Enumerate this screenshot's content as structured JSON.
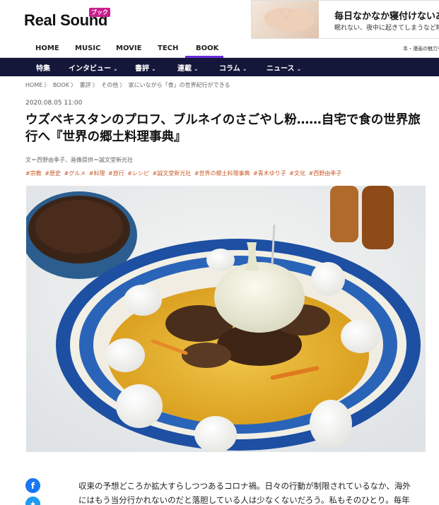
{
  "brand": {
    "logo": "Real Sound",
    "badge": "ブック"
  },
  "ad": {
    "title": "毎日なかなか寝付けないあなたへ",
    "text": "眠れない、夜中に起きてしまうなど睡眠のお悩みを"
  },
  "category_nav": {
    "items": [
      "HOME",
      "MUSIC",
      "MOVIE",
      "TECH",
      "BOOK"
    ],
    "active": "BOOK",
    "right_text": "本・漫画の魅力を伝える"
  },
  "main_nav": {
    "items": [
      {
        "label": "特集",
        "has_menu": false
      },
      {
        "label": "インタビュー",
        "has_menu": true
      },
      {
        "label": "書評",
        "has_menu": true
      },
      {
        "label": "連載",
        "has_menu": true
      },
      {
        "label": "コラム",
        "has_menu": true
      },
      {
        "label": "ニュース",
        "has_menu": true
      }
    ]
  },
  "breadcrumb": [
    "HOME",
    "BOOK",
    "書評",
    "その他",
    "家にいながら「食」の世界紀行ができる"
  ],
  "article": {
    "date": "2020.08.05 11:00",
    "title": "ウズベキスタンのプロフ、ブルネイのさごやし粉……自宅で食の世界旅行へ『世界の郷土料理事典』",
    "credit": "文＝西野由季子、画像提供＝誠文堂新光社",
    "tags": [
      "#宗教",
      "#歴史",
      "#グルメ",
      "#料理",
      "#旅行",
      "#レシピ",
      "#誠文堂新光社",
      "#世界の郷土料理事典",
      "#青木ゆり子",
      "#文化",
      "#西野由季子"
    ],
    "body": "収束の予想どころか拡大すらしつつあるコロナ禍。日々の行動が制限されているなか、海外にはもう当分行かれないのだと落胆している人は少なくないだろう。私もそのひとり。毎年のパリ旅行を楽しみに日々の仕事を頑張っていたのに、とため息をつく日々。"
  },
  "share": {
    "icons": [
      "facebook-icon",
      "twitter-icon"
    ]
  },
  "colors": {
    "accent": "#6c2bd9",
    "nav_bg": "#14173a",
    "tag": "#c85a2a",
    "badge": "#c81e8c"
  }
}
